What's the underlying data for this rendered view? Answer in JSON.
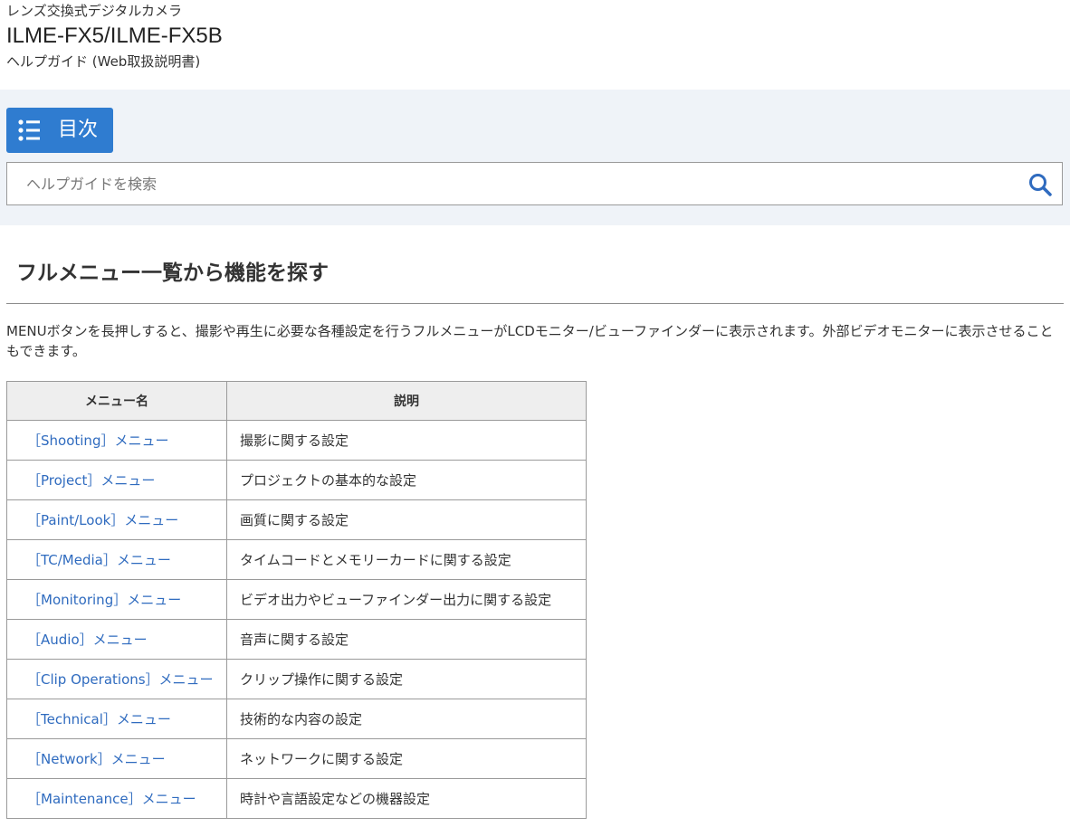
{
  "header": {
    "category": "レンズ交換式デジタルカメラ",
    "model": "ILME-FX5/ILME-FX5B",
    "guide": "ヘルプガイド (Web取扱説明書)"
  },
  "toolbar": {
    "toc_label": "目次",
    "toc_icon": "list-icon",
    "search_placeholder": "ヘルプガイドを検索",
    "search_icon": "search-icon",
    "accent_color": "#2f7cd0"
  },
  "main": {
    "title": "フルメニュー一覧から機能を探す",
    "description": "MENUボタンを長押しすると、撮影や再生に必要な各種設定を行うフルメニューがLCDモニター/ビューファインダーに表示されます。外部ビデオモニターに表示させることもできます。",
    "table": {
      "headers": [
        "メニュー名",
        "説明"
      ],
      "rows": [
        {
          "name": "［Shooting］メニュー",
          "desc": "撮影に関する設定"
        },
        {
          "name": "［Project］メニュー",
          "desc": "プロジェクトの基本的な設定"
        },
        {
          "name": "［Paint/Look］メニュー",
          "desc": "画質に関する設定"
        },
        {
          "name": "［TC/Media］メニュー",
          "desc": "タイムコードとメモリーカードに関する設定"
        },
        {
          "name": "［Monitoring］メニュー",
          "desc": "ビデオ出力やビューファインダー出力に関する設定"
        },
        {
          "name": "［Audio］メニュー",
          "desc": "音声に関する設定"
        },
        {
          "name": "［Clip Operations］メニュー",
          "desc": "クリップ操作に関する設定"
        },
        {
          "name": "［Technical］メニュー",
          "desc": "技術的な内容の設定"
        },
        {
          "name": "［Network］メニュー",
          "desc": "ネットワークに関する設定"
        },
        {
          "name": "［Maintenance］メニュー",
          "desc": "時計や言語設定などの機器設定"
        }
      ]
    }
  }
}
